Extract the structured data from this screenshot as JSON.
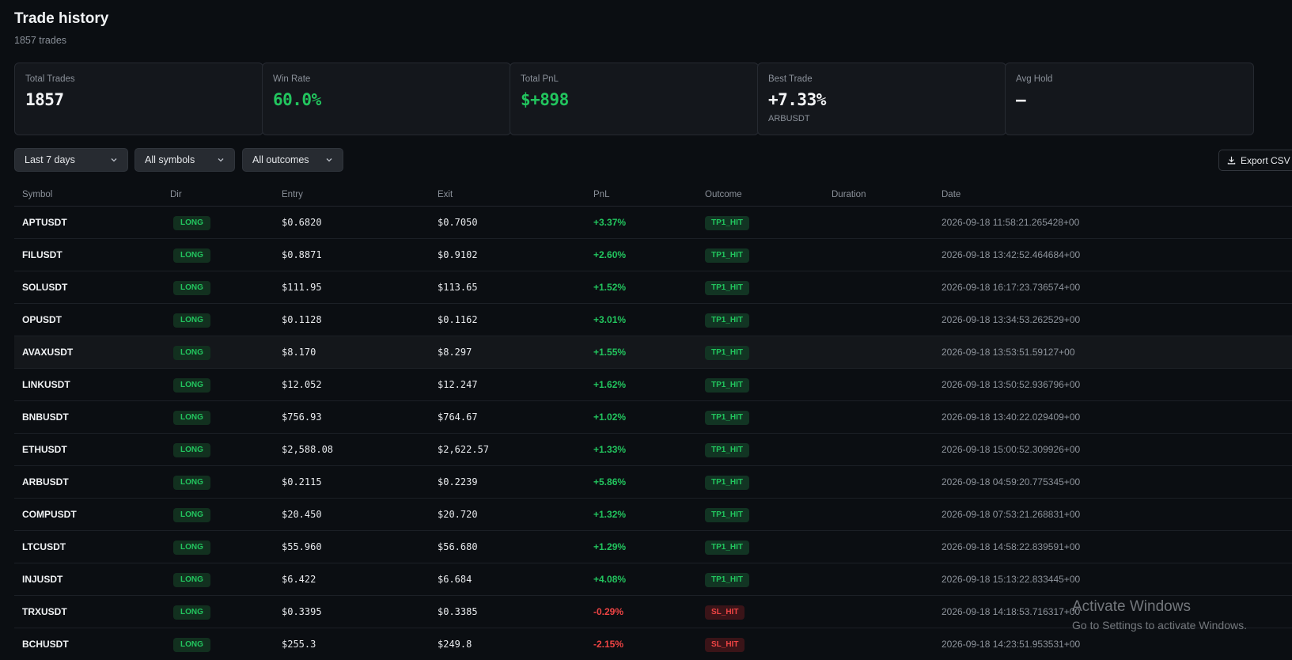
{
  "header": {
    "title": "Trade history",
    "subtitle": "1857 trades"
  },
  "stats": [
    {
      "label": "Total Trades",
      "value": "1857",
      "sub": ""
    },
    {
      "label": "Win Rate",
      "value": "60.0%",
      "sub": ""
    },
    {
      "label": "Total PnL",
      "value": "$+898",
      "sub": ""
    },
    {
      "label": "Best Trade",
      "value": "+7.33%",
      "sub": "ARBUSDT"
    },
    {
      "label": "Avg Hold",
      "value": "—",
      "sub": ""
    }
  ],
  "filters": {
    "period": "Last 7 days",
    "symbols": "All symbols",
    "outcomes": "All outcomes"
  },
  "export_label": "Export CSV",
  "table": {
    "columns": [
      "Symbol",
      "Dir",
      "Entry",
      "Exit",
      "PnL",
      "Outcome",
      "Duration",
      "Date"
    ],
    "rows": [
      {
        "symbol": "APTUSDT",
        "dir": "LONG",
        "entry": "$0.6820",
        "exit": "$0.7050",
        "pnl": "+3.37%",
        "outcome": "TP1_HIT",
        "duration": "",
        "date": "2026-09-18 11:58:21.265428+00"
      },
      {
        "symbol": "FILUSDT",
        "dir": "LONG",
        "entry": "$0.8871",
        "exit": "$0.9102",
        "pnl": "+2.60%",
        "outcome": "TP1_HIT",
        "duration": "",
        "date": "2026-09-18 13:42:52.464684+00"
      },
      {
        "symbol": "SOLUSDT",
        "dir": "LONG",
        "entry": "$111.95",
        "exit": "$113.65",
        "pnl": "+1.52%",
        "outcome": "TP1_HIT",
        "duration": "",
        "date": "2026-09-18 16:17:23.736574+00"
      },
      {
        "symbol": "OPUSDT",
        "dir": "LONG",
        "entry": "$0.1128",
        "exit": "$0.1162",
        "pnl": "+3.01%",
        "outcome": "TP1_HIT",
        "duration": "",
        "date": "2026-09-18 13:34:53.262529+00"
      },
      {
        "symbol": "AVAXUSDT",
        "dir": "LONG",
        "entry": "$8.170",
        "exit": "$8.297",
        "pnl": "+1.55%",
        "outcome": "TP1_HIT",
        "duration": "",
        "date": "2026-09-18 13:53:51.59127+00"
      },
      {
        "symbol": "LINKUSDT",
        "dir": "LONG",
        "entry": "$12.052",
        "exit": "$12.247",
        "pnl": "+1.62%",
        "outcome": "TP1_HIT",
        "duration": "",
        "date": "2026-09-18 13:50:52.936796+00"
      },
      {
        "symbol": "BNBUSDT",
        "dir": "LONG",
        "entry": "$756.93",
        "exit": "$764.67",
        "pnl": "+1.02%",
        "outcome": "TP1_HIT",
        "duration": "",
        "date": "2026-09-18 13:40:22.029409+00"
      },
      {
        "symbol": "ETHUSDT",
        "dir": "LONG",
        "entry": "$2,588.08",
        "exit": "$2,622.57",
        "pnl": "+1.33%",
        "outcome": "TP1_HIT",
        "duration": "",
        "date": "2026-09-18 15:00:52.309926+00"
      },
      {
        "symbol": "ARBUSDT",
        "dir": "LONG",
        "entry": "$0.2115",
        "exit": "$0.2239",
        "pnl": "+5.86%",
        "outcome": "TP1_HIT",
        "duration": "",
        "date": "2026-09-18 04:59:20.775345+00"
      },
      {
        "symbol": "COMPUSDT",
        "dir": "LONG",
        "entry": "$20.450",
        "exit": "$20.720",
        "pnl": "+1.32%",
        "outcome": "TP1_HIT",
        "duration": "",
        "date": "2026-09-18 07:53:21.268831+00"
      },
      {
        "symbol": "LTCUSDT",
        "dir": "LONG",
        "entry": "$55.960",
        "exit": "$56.680",
        "pnl": "+1.29%",
        "outcome": "TP1_HIT",
        "duration": "",
        "date": "2026-09-18 14:58:22.839591+00"
      },
      {
        "symbol": "INJUSDT",
        "dir": "LONG",
        "entry": "$6.422",
        "exit": "$6.684",
        "pnl": "+4.08%",
        "outcome": "TP1_HIT",
        "duration": "",
        "date": "2026-09-18 15:13:22.833445+00"
      },
      {
        "symbol": "TRXUSDT",
        "dir": "LONG",
        "entry": "$0.3395",
        "exit": "$0.3385",
        "pnl": "-0.29%",
        "outcome": "SL_HIT",
        "duration": "",
        "date": "2026-09-18 14:18:53.716317+00"
      },
      {
        "symbol": "BCHUSDT",
        "dir": "LONG",
        "entry": "$255.3",
        "exit": "$249.8",
        "pnl": "-2.15%",
        "outcome": "SL_HIT",
        "duration": "",
        "date": "2026-09-18 14:23:51.953531+00"
      }
    ]
  },
  "watermark": {
    "title": "Activate Windows",
    "subtitle": "Go to Settings to activate Windows."
  },
  "colors": {
    "background": "#0b0e12",
    "card": "#14171c",
    "positive": "#22c55e",
    "negative": "#ef4444",
    "muted": "#8b919a"
  }
}
